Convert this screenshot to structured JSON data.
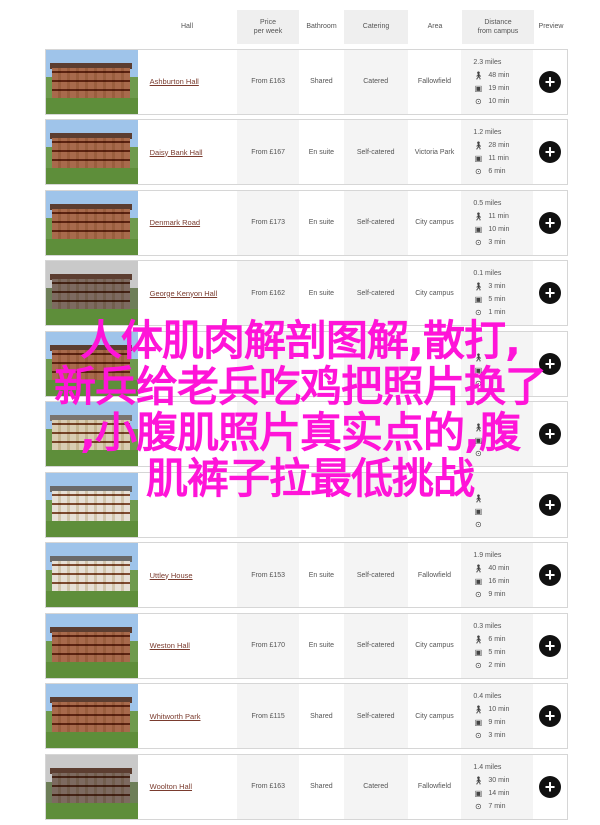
{
  "header": {
    "hall": "Hall",
    "price": "Price\nper week",
    "bathroom": "Bathroom",
    "catering": "Catering",
    "area": "Area",
    "distance": "Distance\nfrom campus",
    "preview": "Preview"
  },
  "rows": [
    {
      "name": "Ashburton Hall",
      "price": "From £163",
      "bathroom": "Shared",
      "catering": "Catered",
      "area": "Fallowfield",
      "miles": "2.3 miles",
      "walk": "48 min",
      "bus": "19 min",
      "cycle": "10 min",
      "thumb": "red"
    },
    {
      "name": "Daisy Bank Hall",
      "price": "From £167",
      "bathroom": "En suite",
      "catering": "Self-catered",
      "area": "Victoria Park",
      "miles": "1.2 miles",
      "walk": "28 min",
      "bus": "11 min",
      "cycle": "6 min",
      "thumb": "red"
    },
    {
      "name": "Denmark Road",
      "price": "From £173",
      "bathroom": "En suite",
      "catering": "Self-catered",
      "area": "City campus",
      "miles": "0.5 miles",
      "walk": "11 min",
      "bus": "10 min",
      "cycle": "3 min",
      "thumb": "red"
    },
    {
      "name": "George Kenyon Hall",
      "price": "From £162",
      "bathroom": "En suite",
      "catering": "Self-catered",
      "area": "City campus",
      "miles": "0.1 miles",
      "walk": "3 min",
      "bus": "5 min",
      "cycle": "1 min",
      "thumb": "grey"
    },
    {
      "name": "",
      "price": "",
      "bathroom": "",
      "catering": "",
      "area": "",
      "miles": "",
      "walk": "",
      "bus": "",
      "cycle": "",
      "thumb": "red"
    },
    {
      "name": "",
      "price": "",
      "bathroom": "",
      "catering": "",
      "area": "",
      "miles": "",
      "walk": "",
      "bus": "",
      "cycle": "",
      "thumb": "cream"
    },
    {
      "name": "",
      "price": "",
      "bathroom": "",
      "catering": "",
      "area": "",
      "miles": "",
      "walk": "",
      "bus": "",
      "cycle": "",
      "thumb": "white"
    },
    {
      "name": "Uttley House",
      "price": "From £153",
      "bathroom": "En suite",
      "catering": "Self-catered",
      "area": "Fallowfield",
      "miles": "1.9 miles",
      "walk": "40 min",
      "bus": "16 min",
      "cycle": "9 min",
      "thumb": "white"
    },
    {
      "name": "Weston Hall",
      "price": "From £170",
      "bathroom": "En suite",
      "catering": "Self-catered",
      "area": "City campus",
      "miles": "0.3 miles",
      "walk": "6 min",
      "bus": "5 min",
      "cycle": "2 min",
      "thumb": "red"
    },
    {
      "name": "Whitworth Park",
      "price": "From £115",
      "bathroom": "Shared",
      "catering": "Self-catered",
      "area": "City campus",
      "miles": "0.4 miles",
      "walk": "10 min",
      "bus": "9 min",
      "cycle": "3 min",
      "thumb": "red"
    },
    {
      "name": "Woolton Hall",
      "price": "From £163",
      "bathroom": "Shared",
      "catering": "Catered",
      "area": "Fallowfield",
      "miles": "1.4 miles",
      "walk": "30 min",
      "bus": "14 min",
      "cycle": "7 min",
      "thumb": "grey"
    }
  ],
  "icons": {
    "walk": "walking-person-icon",
    "bus": "bus-icon",
    "cycle": "bicycle-icon",
    "preview": "plus-icon"
  },
  "overlay": {
    "line1": "人体肌肉解剖图解,散打,",
    "line2": "新兵给老兵吃鸡把照片换了",
    "line3": ",小腹肌照片真实点的,腹",
    "line4": "肌裤子拉最低挑战"
  },
  "colors": {
    "link": "#7a3b2e",
    "overlay": "#ff14d8",
    "button": "#111111"
  }
}
